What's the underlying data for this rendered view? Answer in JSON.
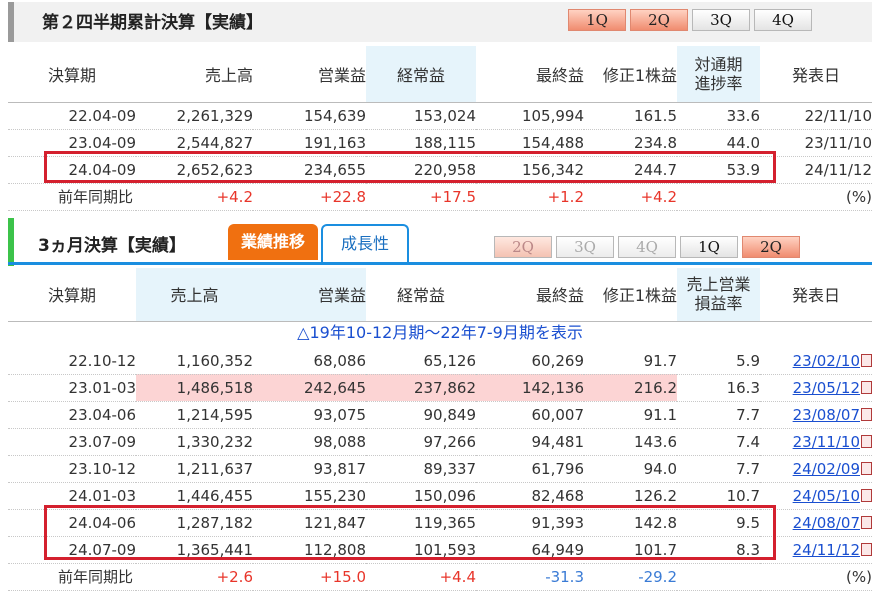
{
  "sec1": {
    "title": "第２四半期累計決算【実績】",
    "tabs": [
      "1Q",
      "2Q",
      "3Q",
      "4Q"
    ],
    "headers": [
      "決算期",
      "売上高",
      "営業益",
      "経常益",
      "最終益",
      "修正1株益",
      "対通期\n進捗率",
      "発表日"
    ],
    "rows": [
      [
        "22.04-09",
        "2,261,329",
        "154,639",
        "153,024",
        "105,994",
        "161.5",
        "33.6",
        "22/11/10"
      ],
      [
        "23.04-09",
        "2,544,827",
        "191,163",
        "188,115",
        "154,488",
        "234.8",
        "44.0",
        "23/11/10"
      ],
      [
        "24.04-09",
        "2,652,623",
        "234,655",
        "220,958",
        "156,342",
        "244.7",
        "53.9",
        "24/11/12"
      ]
    ],
    "yoy": [
      "前年同期比",
      "+4.2",
      "+22.8",
      "+17.5",
      "+1.2",
      "+4.2",
      "",
      "(%)"
    ]
  },
  "sec2": {
    "title": "3ヵ月決算【実績】",
    "tab_active": "業績推移",
    "tab_other": "成長性",
    "tabs": [
      "2Q",
      "3Q",
      "4Q",
      "1Q",
      "2Q"
    ],
    "headers": [
      "決算期",
      "売上高",
      "営業益",
      "経常益",
      "最終益",
      "修正1株益",
      "売上営業\n損益率",
      "発表日"
    ],
    "notice": "△19年10-12月期～22年7-9月期を表示",
    "rows": [
      [
        "22.10-12",
        "1,160,352",
        "68,086",
        "65,126",
        "60,269",
        "91.7",
        "5.9",
        "23/02/10"
      ],
      [
        "23.01-03",
        "1,486,518",
        "242,645",
        "237,862",
        "142,136",
        "216.2",
        "16.3",
        "23/05/12"
      ],
      [
        "23.04-06",
        "1,214,595",
        "93,075",
        "90,849",
        "60,007",
        "91.1",
        "7.7",
        "23/08/07"
      ],
      [
        "23.07-09",
        "1,330,232",
        "98,088",
        "97,266",
        "94,481",
        "143.6",
        "7.4",
        "23/11/10"
      ],
      [
        "23.10-12",
        "1,211,637",
        "93,817",
        "89,337",
        "61,796",
        "94.0",
        "7.7",
        "24/02/09"
      ],
      [
        "24.01-03",
        "1,446,455",
        "155,230",
        "150,096",
        "82,468",
        "126.2",
        "10.7",
        "24/05/10"
      ],
      [
        "24.04-06",
        "1,287,182",
        "121,847",
        "119,365",
        "91,393",
        "142.8",
        "9.5",
        "24/08/07"
      ],
      [
        "24.07-09",
        "1,365,441",
        "112,808",
        "101,593",
        "64,949",
        "101.7",
        "8.3",
        "24/11/12"
      ]
    ],
    "yoy": [
      "前年同期比",
      "+2.6",
      "+15.0",
      "+4.4",
      "-31.3",
      "-29.2",
      "",
      "(%)"
    ]
  },
  "colors": {
    "positive": "#e8352a",
    "negative": "#3a7bd5",
    "highlight_box": "#d4202e",
    "active_tab": "#f07010",
    "header_hl": "#e6f4fb",
    "pink_row": "#fcd4d4"
  },
  "icons": {
    "report": "pdf-icon"
  }
}
